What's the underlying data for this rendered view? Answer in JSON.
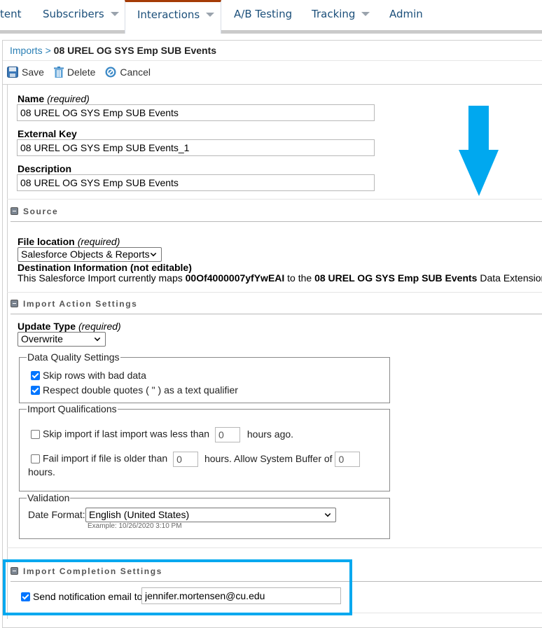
{
  "topnav": {
    "items": [
      {
        "label": "tent",
        "has_caret": false
      },
      {
        "label": "Subscribers",
        "has_caret": true
      },
      {
        "label": "Interactions",
        "has_caret": true,
        "active": true
      },
      {
        "label": "A/B Testing",
        "has_caret": false
      },
      {
        "label": "Tracking",
        "has_caret": true
      },
      {
        "label": "Admin",
        "has_caret": false
      }
    ],
    "active_color": "#a53b06"
  },
  "breadcrumb": {
    "parent": "Imports",
    "separator": ">",
    "current": "08 UREL OG SYS Emp SUB Events"
  },
  "toolbar": {
    "save_label": "Save",
    "delete_label": "Delete",
    "cancel_label": "Cancel"
  },
  "general": {
    "name_label": "Name",
    "name_required": "(required)",
    "name_value": "08 UREL OG SYS Emp SUB Events",
    "external_key_label": "External Key",
    "external_key_value": "08 UREL OG SYS Emp SUB Events_1",
    "description_label": "Description",
    "description_value": "08 UREL OG SYS Emp SUB Events"
  },
  "source": {
    "section_title": "Source",
    "file_location_label": "File location",
    "file_location_required": "(required)",
    "file_location_value": "Salesforce Objects & Reports",
    "destination_label": "Destination Information (not editable)",
    "destination_prefix": "This Salesforce Import currently maps",
    "destination_object_id": "00Of4000007yfYwEAI",
    "destination_middle": "to the",
    "destination_extension": "08 UREL OG SYS Emp SUB Events",
    "destination_suffix": "Data Extension"
  },
  "import_action": {
    "section_title": "Import Action Settings",
    "update_type_label": "Update Type",
    "update_type_required": "(required)",
    "update_type_value": "Overwrite",
    "data_quality": {
      "legend": "Data Quality Settings",
      "skip_bad_rows_label": "Skip rows with bad data",
      "skip_bad_rows_checked": true,
      "respect_quotes_label": "Respect double quotes ( \" ) as a text qualifier",
      "respect_quotes_checked": true
    },
    "qualifications": {
      "legend": "Import Qualifications",
      "skip_label_before": "Skip import if last import was less than",
      "skip_hours_value": "0",
      "skip_label_after": "hours ago.",
      "skip_checked": false,
      "fail_label_before": "Fail import if file is older than",
      "fail_hours_value": "0",
      "fail_label_middle": "hours. Allow System Buffer of",
      "buffer_value": "0",
      "fail_label_after": "hours.",
      "fail_checked": false
    },
    "validation": {
      "legend": "Validation",
      "date_format_label": "Date Format:",
      "date_format_value": "English (United States)",
      "example_text": "Example: 10/26/2020 3:10 PM"
    }
  },
  "completion": {
    "section_title": "Import Completion Settings",
    "notify_label": "Send notification email to",
    "notify_checked": true,
    "notify_email": "jennifer.mortensen@cu.edu"
  },
  "annotations": {
    "arrow_color": "#00a8ef",
    "highlight_color": "#00a8ef"
  }
}
